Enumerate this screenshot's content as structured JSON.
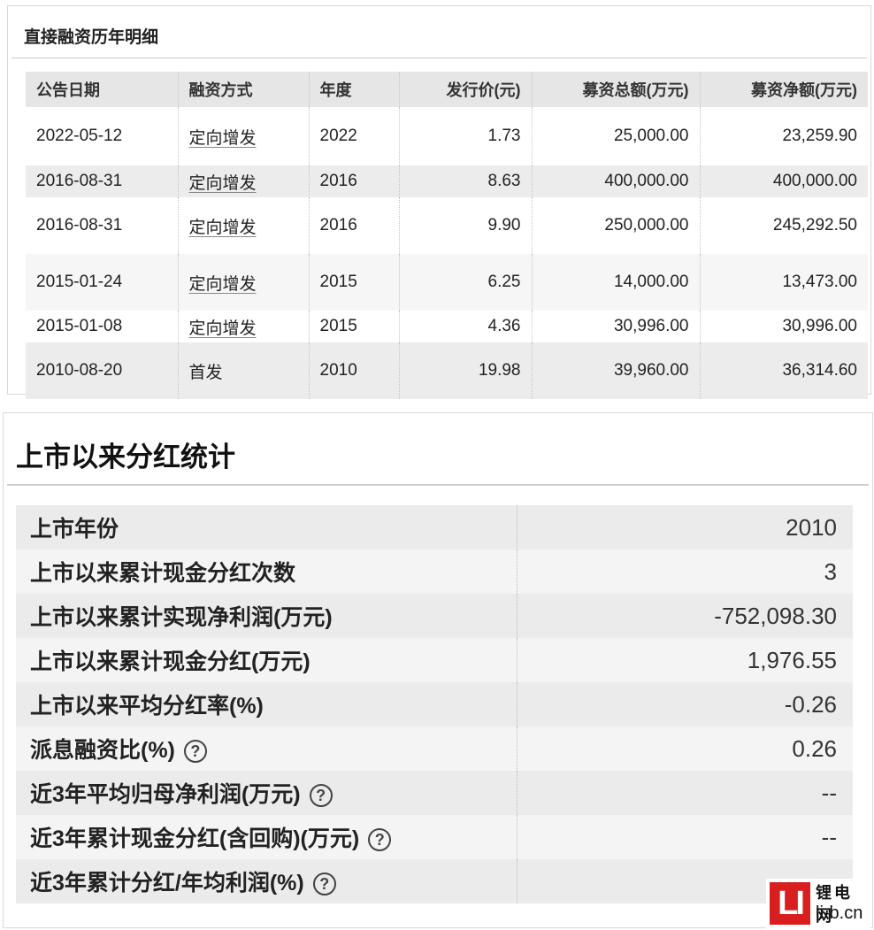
{
  "financing": {
    "title": "直接融资历年明细",
    "headers": [
      "公告日期",
      "融资方式",
      "年度",
      "发行价(元)",
      "募资总额(万元)",
      "募资净额(万元)"
    ],
    "rows": [
      {
        "date": "2022-05-12",
        "method": "定向增发",
        "year": "2022",
        "price": "1.73",
        "total": "25,000.00",
        "net": "23,259.90"
      },
      {
        "date": "2016-08-31",
        "method": "定向增发",
        "year": "2016",
        "price": "8.63",
        "total": "400,000.00",
        "net": "400,000.00"
      },
      {
        "date": "2016-08-31",
        "method": "定向增发",
        "year": "2016",
        "price": "9.90",
        "total": "250,000.00",
        "net": "245,292.50"
      },
      {
        "date": "2015-01-24",
        "method": "定向增发",
        "year": "2015",
        "price": "6.25",
        "total": "14,000.00",
        "net": "13,473.00"
      },
      {
        "date": "2015-01-08",
        "method": "定向增发",
        "year": "2015",
        "price": "4.36",
        "total": "30,996.00",
        "net": "30,996.00"
      },
      {
        "date": "2010-08-20",
        "method": "首发",
        "year": "2010",
        "price": "19.98",
        "total": "39,960.00",
        "net": "36,314.60"
      }
    ]
  },
  "dividend": {
    "title": "上市以来分红统计",
    "rows": [
      {
        "label": "上市年份",
        "value": "2010"
      },
      {
        "label": "上市以来累计现金分红次数",
        "value": "3"
      },
      {
        "label": "上市以来累计实现净利润(万元)",
        "value": "-752,098.30"
      },
      {
        "label": "上市以来累计现金分红(万元)",
        "value": "1,976.55"
      },
      {
        "label": "上市以来平均分红率(%)",
        "value": "-0.26"
      },
      {
        "label": "派息融资比(%)",
        "value": "0.26"
      },
      {
        "label": "近3年平均归母净利润(万元)",
        "value": "--"
      },
      {
        "label": "近3年累计现金分红(含回购)(万元)",
        "value": "--"
      },
      {
        "label": "近3年累计分红/年均利润(%)",
        "value": ""
      }
    ],
    "help_glyph": "?"
  },
  "watermark": {
    "logo": "LI",
    "cn": "锂电网",
    "en": "li-b.cn"
  }
}
